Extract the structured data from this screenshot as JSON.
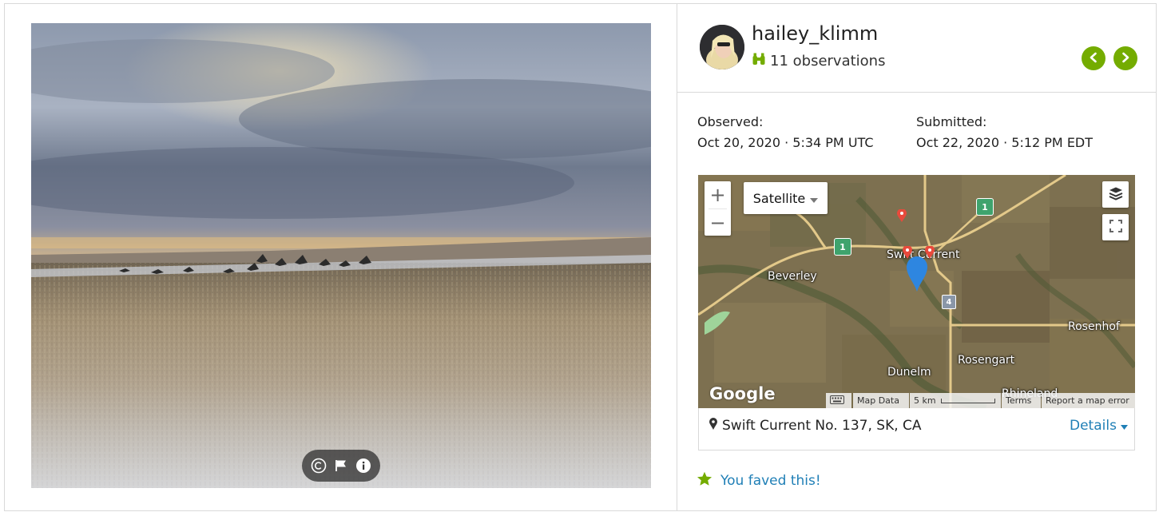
{
  "observer": {
    "username": "hailey_klimm",
    "observations_label": "11 observations"
  },
  "navigation": {
    "previous_icon": "chevron-left",
    "next_icon": "chevron-right"
  },
  "dates": {
    "observed_label": "Observed:",
    "observed_value": "Oct 20, 2020 · 5:34 PM UTC",
    "submitted_label": "Submitted:",
    "submitted_value": "Oct 22, 2020 · 5:12 PM EDT"
  },
  "map": {
    "map_type": "Satellite",
    "zoom_in": "+",
    "zoom_out": "−",
    "places": [
      "Swift Current",
      "Beverley",
      "Rosenhof",
      "Rosengart",
      "Dunelm",
      "Rhineland"
    ],
    "highway_labels": [
      "1",
      "1",
      "4"
    ],
    "logo": "Google",
    "attribution": {
      "map_data": "Map Data",
      "scale": "5 km",
      "terms": "Terms",
      "report": "Report a map error"
    }
  },
  "location": {
    "text": "Swift Current No. 137, SK, CA",
    "details_label": "Details"
  },
  "fave": {
    "label": "You faved this!"
  },
  "colors": {
    "accent_green": "#74ac00",
    "link_blue": "#1f7fb6"
  }
}
